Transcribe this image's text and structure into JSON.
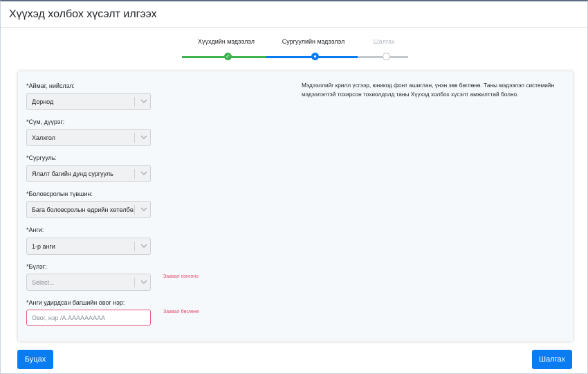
{
  "window": {
    "title": "Хүүхэд холбох хүсэлт илгээх"
  },
  "stepper": {
    "steps": [
      {
        "label": "Хүүхдийн мэдээлэл",
        "state": "done"
      },
      {
        "label": "Сургуулийн мэдээлэл",
        "state": "active"
      },
      {
        "label": "Шалгах",
        "state": "pending"
      }
    ]
  },
  "form": {
    "fields": [
      {
        "label": "*Аймаг, нийслэл:",
        "value": "Дорнод",
        "placeholder": ""
      },
      {
        "label": "*Сум, дүүрэг:",
        "value": "Халхгол",
        "placeholder": ""
      },
      {
        "label": "*Сургууль:",
        "value": "Ялалт багийн дунд сургууль",
        "placeholder": ""
      },
      {
        "label": "*Боловсролын түвшин:",
        "value": "Бага боловсролын өдрийн хөтөлбө...",
        "placeholder": ""
      },
      {
        "label": "*Анги:",
        "value": "1-р анги",
        "placeholder": ""
      },
      {
        "label": "*Бүлэг:",
        "value": "",
        "placeholder": "Select...",
        "error": "Заавал сонгоно"
      },
      {
        "label": "*Анги удирдсан багшийн овог нэр:",
        "value": "",
        "placeholder": "Овог, нэр /А.ААААААААА",
        "error": "Заавал бөглөнө"
      }
    ],
    "info_text": "Мэдээллийг крилл үсгээр, юникод фонт ашиглан, үнэн зөв бөглөнө. Таны мэдээлэл системийн мэдээлэлтэй тохирсон тохиолдолд таны Хүүхэд холбох хүсэлт амжилттай болно."
  },
  "footer": {
    "back_label": "Буцах",
    "submit_label": "Шалгах"
  },
  "colors": {
    "accent": "#0a7cf2",
    "success": "#3fb34f",
    "error": "#e04a6c",
    "pending": "#c4c8cc"
  },
  "icons": {
    "dropdown": "chevron-down-icon",
    "done_step": "check-icon"
  }
}
